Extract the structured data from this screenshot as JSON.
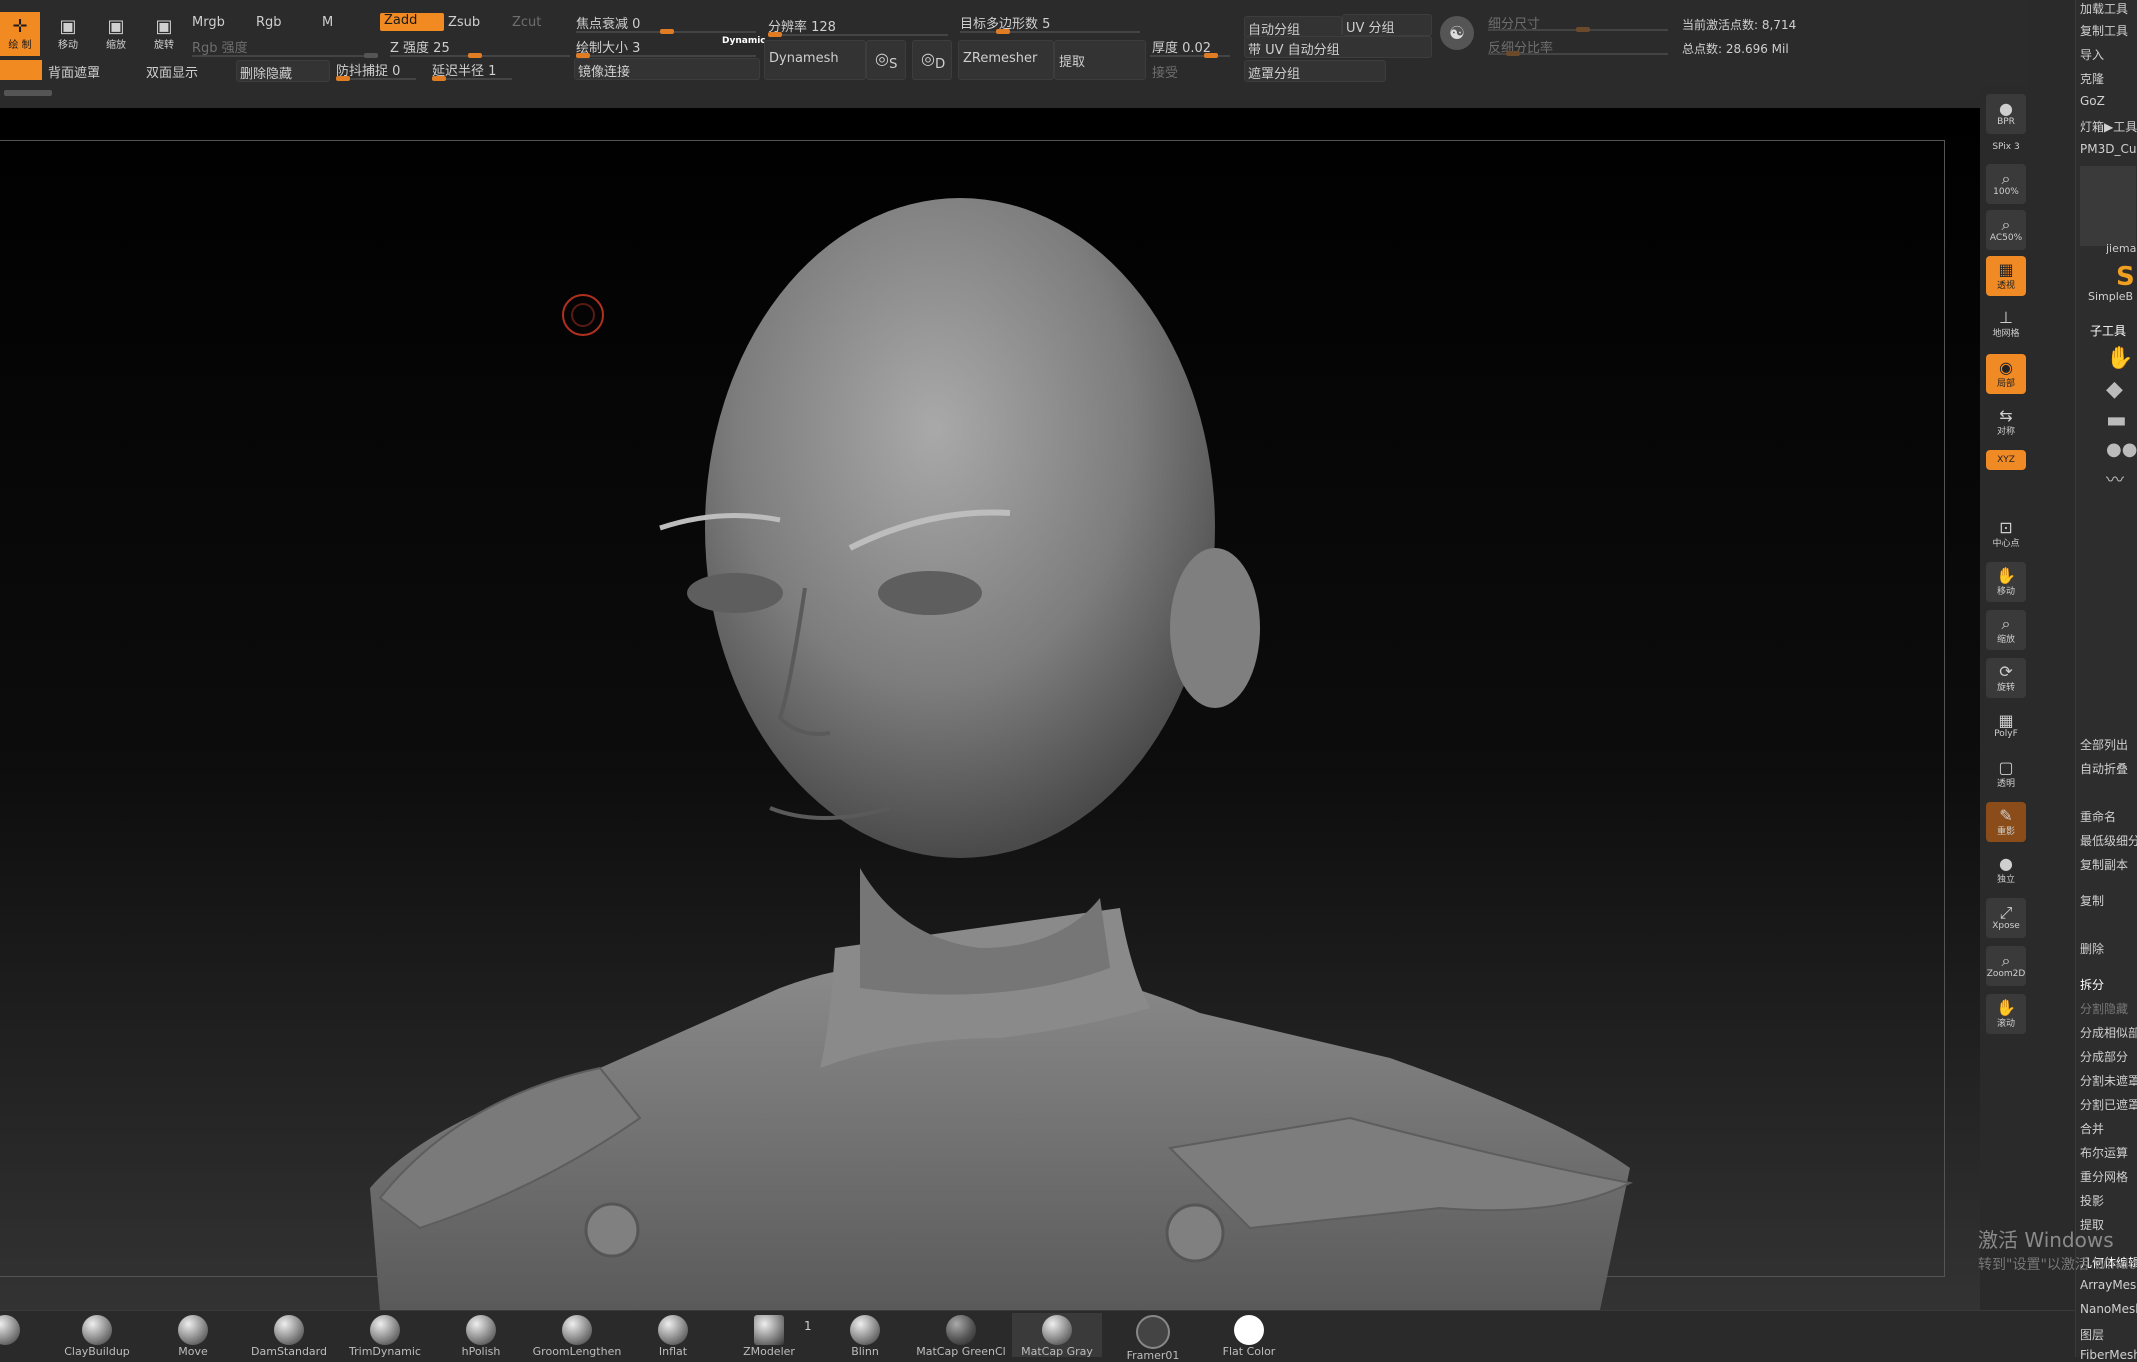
{
  "toolbar": {
    "draw_label": "绘 制",
    "move_label": "移动",
    "scale_label": "缩放",
    "rotate_label": "旋转",
    "mrgb": "Mrgb",
    "rgb": "Rgb",
    "m": "M",
    "zadd": "Zadd",
    "zsub": "Zsub",
    "zcut": "Zcut",
    "rgb_intensity": "Rgb 强度",
    "z_intensity": "Z 强度 25",
    "focal_shift": "焦点衰减 0",
    "draw_size": "绘制大小 3",
    "dynamic": "Dynamic",
    "mirror_weld": "镜像连接",
    "resolution": "分辨率 128",
    "dynamesh": "Dynamesh",
    "target_polycount": "目标多边形数 5",
    "zremesher": "ZRemesher",
    "extract": "提取",
    "thickness": "厚度 0.02",
    "accept": "接受",
    "auto_groups": "自动分组",
    "uv_groups": "UV 分组",
    "auto_groups_uv": "带 UV 自动分组",
    "mask_groups": "遮罩分组",
    "subdiv_size": "细分尺寸",
    "subdiv_ratio": "反细分比率",
    "active_points": "当前激活点数: 8,714",
    "total_points": "总点数: 28.696 Mil",
    "backface_mask": "背面遮罩",
    "double_sided": "双面显示",
    "del_hidden": "删除隐藏",
    "snap": "防抖捕捉 0",
    "lazy_radius": "延迟半径 1",
    "sub_a": "S",
    "sub_d": "D"
  },
  "right_tools": [
    {
      "label": "BPR",
      "icon": "bpr-sphere-icon"
    },
    {
      "label": "SPix 3",
      "icon": "spix-icon"
    },
    {
      "label": "100%",
      "icon": "zoom-100-icon"
    },
    {
      "label": "AC50%",
      "icon": "ac50-icon"
    },
    {
      "label": "透视",
      "icon": "perspective-icon"
    },
    {
      "label": "地网格",
      "icon": "floor-icon"
    },
    {
      "label": "局部",
      "icon": "local-icon"
    },
    {
      "label": "对称",
      "icon": "symmetry-icon"
    },
    {
      "label": "XYZ",
      "icon": "xyz-icon"
    },
    {
      "label": "中心点",
      "icon": "center-icon"
    },
    {
      "label": "移动",
      "icon": "move-hand-icon"
    },
    {
      "label": "缩放",
      "icon": "scale-icon"
    },
    {
      "label": "旋转",
      "icon": "rotate-icon"
    },
    {
      "label": "PolyF",
      "icon": "polyframe-icon"
    },
    {
      "label": "透明",
      "icon": "transparent-icon"
    },
    {
      "label": "重影",
      "icon": "ghost-icon"
    },
    {
      "label": "独立",
      "icon": "solo-icon"
    },
    {
      "label": "Xpose",
      "icon": "xpose-icon"
    },
    {
      "label": "Zoom2D",
      "icon": "zoom2d-icon"
    },
    {
      "label": "滚动",
      "icon": "scroll-hand-icon"
    }
  ],
  "right_panel": {
    "items_top": [
      "加载工具",
      "复制工具",
      "导入",
      "克隆",
      "GoZ",
      "灯箱▶工具",
      "PM3D_Cu"
    ],
    "thumb_label": "jiema",
    "simple_label": "SimpleB",
    "subtool_header": "子工具",
    "items_bottom": [
      "全部列出",
      "自动折叠",
      "重命名",
      "最低级细分",
      "复制副本",
      "复制",
      "删除",
      "拆分",
      "分割隐藏",
      "分成相似部",
      "分成部分",
      "分割未遮罩",
      "分割已遮罩",
      "合并",
      "布尔运算",
      "重分网格",
      "投影",
      "提取",
      "几何体编辑",
      "ArrayMesh",
      "NanoMesh",
      "图层",
      "FiberMesh"
    ]
  },
  "brushes": [
    "",
    "ClayBuildup",
    "Move",
    "DamStandard",
    "TrimDynamic",
    "hPolish",
    "GroomLengthen",
    "Inflat",
    "ZModeler",
    "Blinn",
    "MatCap GreenCl",
    "MatCap Gray",
    "Framer01",
    "Flat Color"
  ],
  "brush_count": "1",
  "watermark": {
    "title": "激活 Windows",
    "sub": "转到\"设置\"以激活 Windows。"
  },
  "colors": {
    "accent": "#f28a22",
    "panel": "#2b2b2b"
  }
}
